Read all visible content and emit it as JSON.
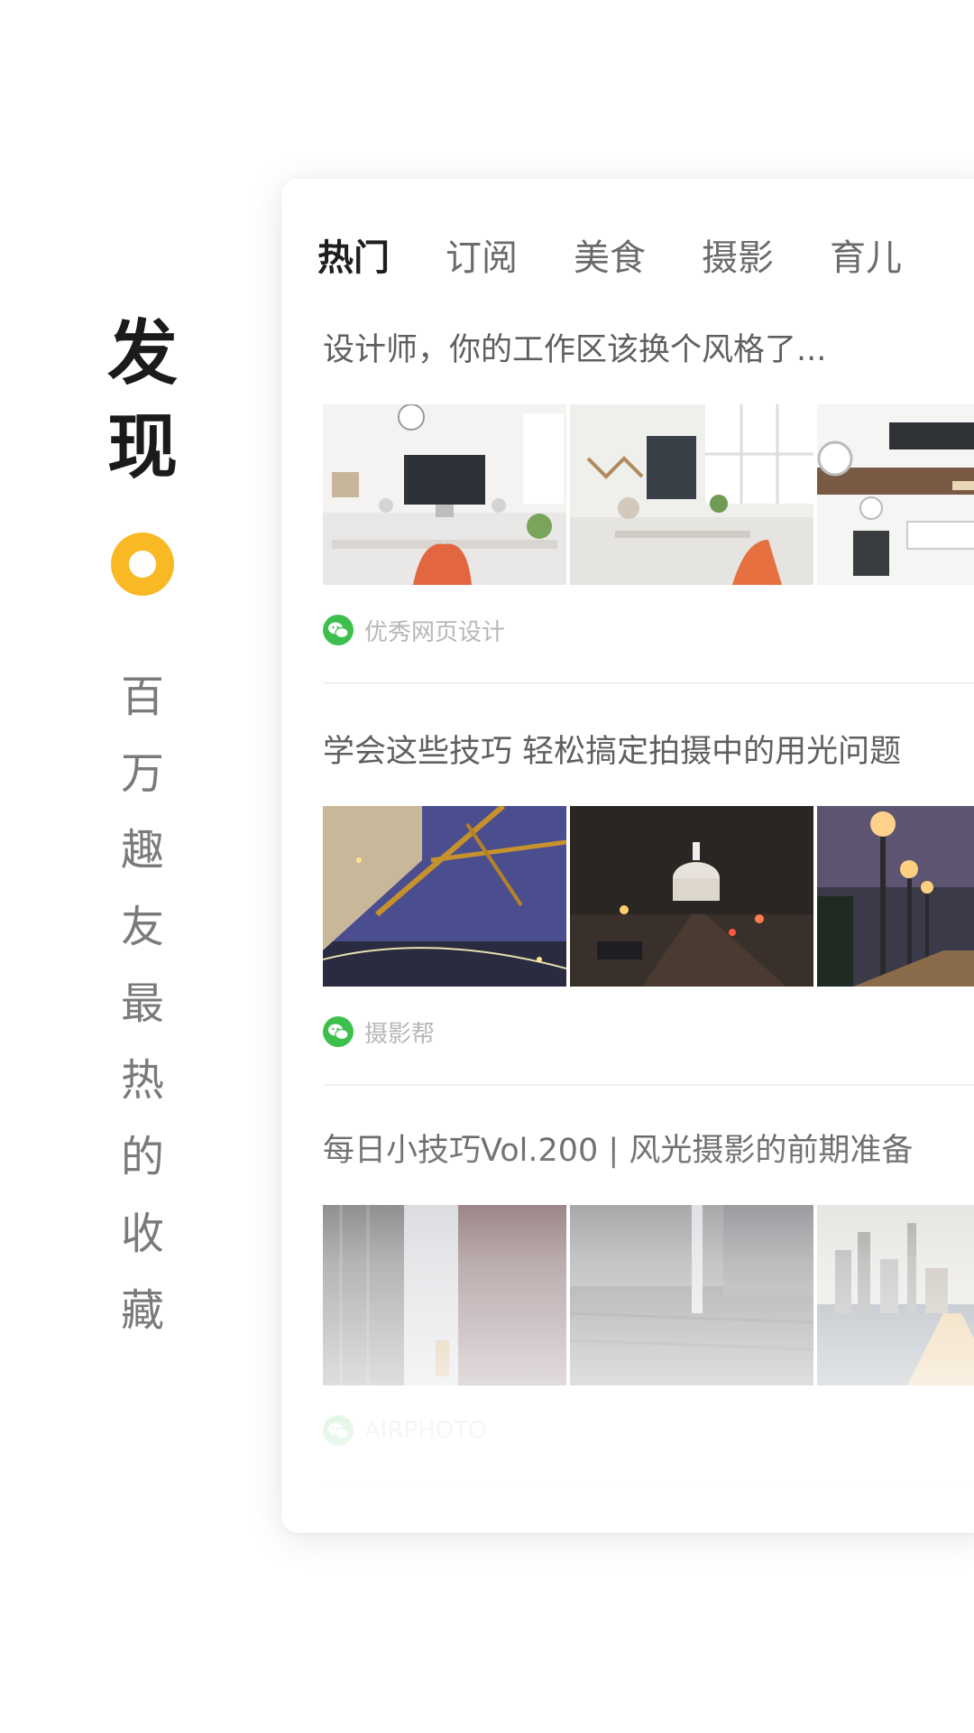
{
  "left_panel": {
    "title_chars": [
      "发",
      "现"
    ],
    "slogan_chars": [
      "百",
      "万",
      "趣",
      "友",
      "最",
      "热",
      "的",
      "收",
      "藏"
    ]
  },
  "colors": {
    "accent": "#f9b925",
    "wechat_green": "#3dbf4d"
  },
  "tabs": [
    {
      "label": "热门",
      "active": true
    },
    {
      "label": "订阅",
      "active": false
    },
    {
      "label": "美食",
      "active": false
    },
    {
      "label": "摄影",
      "active": false
    },
    {
      "label": "育儿",
      "active": false
    }
  ],
  "articles": [
    {
      "title": "设计师，你的工作区该换个风格了...",
      "source": "优秀网页设计",
      "source_icon": "wechat-icon"
    },
    {
      "title": "学会这些技巧 轻松搞定拍摄中的用光问题",
      "source": "摄影帮",
      "source_icon": "wechat-icon"
    },
    {
      "title": "每日小技巧Vol.200 | 风光摄影的前期准备",
      "source": "AIRPHOTO",
      "source_icon": "wechat-icon"
    }
  ]
}
